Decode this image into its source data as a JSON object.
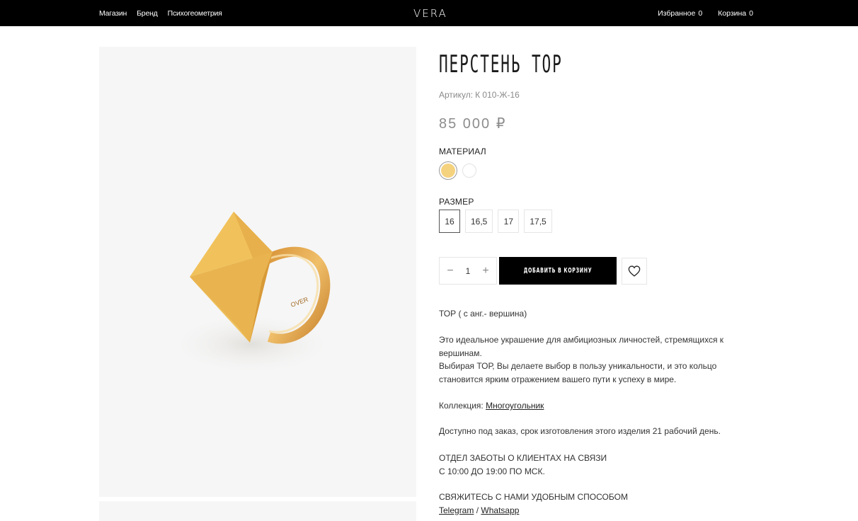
{
  "header": {
    "nav_left": [
      "Магазин",
      "Бренд",
      "Психогеометрия"
    ],
    "logo": "VERA",
    "favorites_label": "Избранное",
    "favorites_count": "0",
    "cart_label": "Корзина",
    "cart_count": "0"
  },
  "product": {
    "title": "ПЕРСТЕНЬ ТОР",
    "sku_label": "Артикул:",
    "sku_value": "К 010-Ж-16",
    "price": "85 000 ₽",
    "material_label": "МАТЕРИАЛ",
    "materials": [
      {
        "color": "#f5d27e",
        "selected": true
      },
      {
        "color": "#ffffff",
        "selected": false
      }
    ],
    "size_label": "РАЗМЕР",
    "sizes": [
      {
        "label": "16",
        "selected": true
      },
      {
        "label": "16,5",
        "selected": false
      },
      {
        "label": "17",
        "selected": false
      },
      {
        "label": "17,5",
        "selected": false
      }
    ],
    "quantity": "1",
    "add_to_cart_label": "ДОБАВИТЬ В КОРЗИНУ",
    "ring_engraving": "OVER"
  },
  "description": {
    "meaning": "ТОР ( с анг.- вершина)",
    "para1_line1": "Это идеальное украшение для амбициозных личностей, стремящихся к",
    "para1_line2": "вершинам.",
    "para2_line1": "Выбирая ТОР, Вы делаете выбор в пользу уникальности, и это кольцо",
    "para2_line2": "становится ярким отражением вашего пути к успеху в мире.",
    "collection_label": "Коллекция:",
    "collection_link": "Многоугольник",
    "availability": "Доступно под заказ, срок изготовления этого изделия 21 рабочий день.",
    "care_line1": "ОТДЕЛ ЗАБОТЫ О КЛИЕНТАХ НА СВЯЗИ",
    "care_line2": "С 10:00 ДО 19:00 ПО МСК.",
    "contact_heading": "СВЯЖИТЕСЬ С НАМИ УДОБНЫМ СПОСОБОМ",
    "contact_telegram": "Telegram",
    "contact_separator": "/",
    "contact_whatsapp": "Whatsapp"
  },
  "colors": {
    "header_bg": "#000000",
    "gallery_bg": "#f6f6f6",
    "gold": "#e8b650",
    "price_text": "#8c8c8c"
  }
}
